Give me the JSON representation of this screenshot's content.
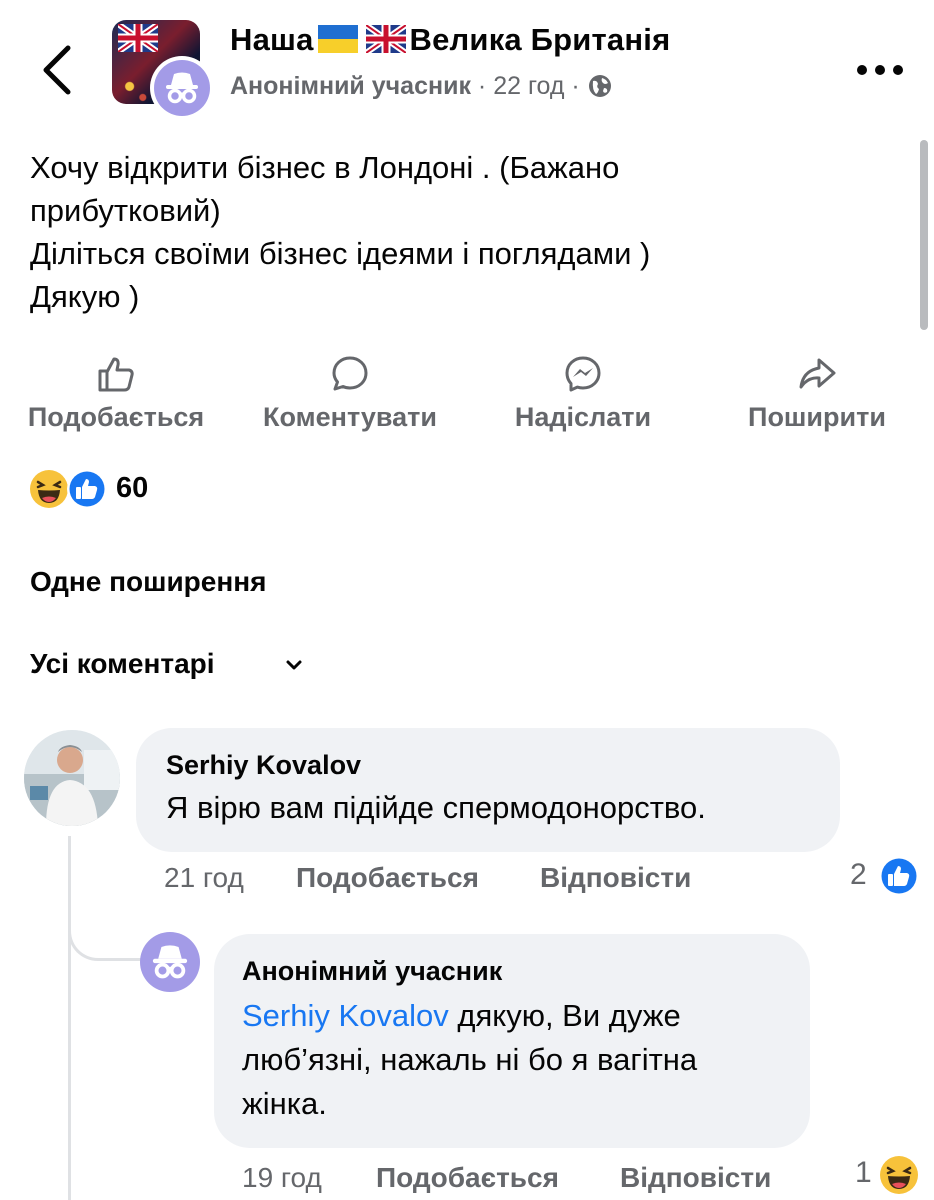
{
  "header": {
    "group_name_part1": "Наша",
    "group_name_part2": "Велика Британія",
    "author": "Анонімний учасник",
    "separator": "·",
    "time": "22 год",
    "privacy_icon": "globe-icon",
    "flag_icons": [
      "ukraine-flag-icon",
      "uk-flag-icon"
    ]
  },
  "post": {
    "lines": [
      "Хочу відкрити бізнес в Лондоні . (Бажано",
      "прибутковий)",
      "Діліться своїми бізнес ідеями і поглядами )",
      "Дякую )"
    ]
  },
  "actions": {
    "like": "Подобається",
    "comment": "Коментувати",
    "send": "Надіслати",
    "share": "Поширити"
  },
  "reactions": {
    "count": "60",
    "icons": [
      "haha-icon",
      "like-icon"
    ]
  },
  "shares_text": "Одне поширення",
  "comments_filter": "Усі коментарі",
  "comments": [
    {
      "author": "Serhiy Kovalov",
      "text": "Я вірю вам підійде спермодонорство.",
      "time": "21 год",
      "like": "Подобається",
      "reply": "Відповісти",
      "reaction_count": "2",
      "reaction_icon": "like-icon"
    },
    {
      "author": "Анонімний учасник",
      "mention": "Serhiy Kovalov",
      "text_line1": "дякую, Ви дуже",
      "text_line2": "люб’язні, нажаль ні бо я вагітна",
      "text_line3": "жінка.",
      "time": "19 год",
      "like": "Подобається",
      "reply": "Відповісти",
      "reaction_count": "1",
      "reaction_icon": "haha-icon"
    }
  ],
  "colors": {
    "link": "#1877f2",
    "secondary_text": "#65676b",
    "bubble": "#f0f2f5",
    "anon_avatar": "#a39be7"
  }
}
